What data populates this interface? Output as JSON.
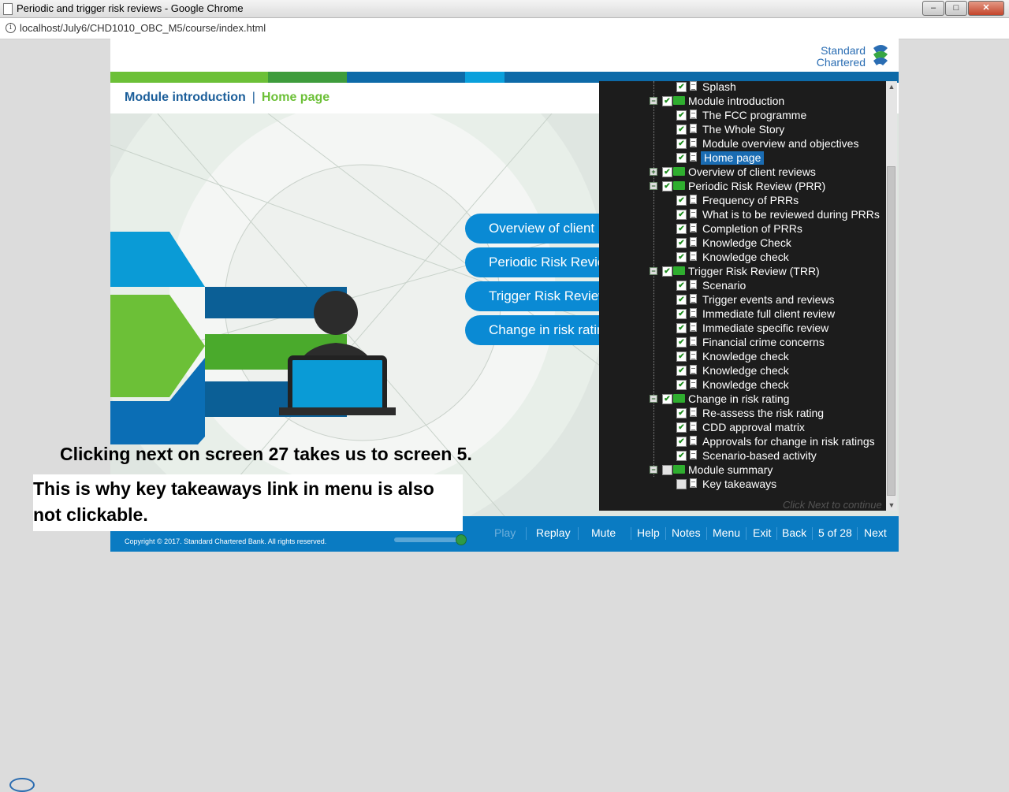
{
  "window": {
    "title": "Periodic and trigger risk reviews - Google Chrome",
    "url": "localhost/July6/CHD1010_OBC_M5/course/index.html",
    "controls": [
      "minimize-icon",
      "maximize-icon",
      "close-icon"
    ]
  },
  "course": {
    "logo": {
      "line1": "Standard",
      "line2": "Chartered",
      "icon": "standard-chartered-logo-icon"
    },
    "stripe_colors": [
      "#6cc037",
      "#3e9c3c",
      "#0d6aa8",
      "#0aa0dc",
      "#0d6aa8"
    ],
    "breadcrumb": {
      "section": "Module introduction",
      "page": "Home page"
    },
    "menu_items": [
      "Overview of client reviews",
      "Periodic Risk Review (PRR)",
      "Trigger Risk Review (TRR)",
      "Change in risk ratings"
    ],
    "footer": {
      "copyright": "Copyright © 2017. Standard Chartered Bank. All rights reserved.",
      "volume_level": 1.0,
      "nav": {
        "play": "Play",
        "replay": "Replay",
        "mute": "Mute",
        "help": "Help",
        "notes": "Notes",
        "menu": "Menu",
        "exit": "Exit",
        "back": "Back",
        "page_indicator": "5 of 28",
        "next": "Next"
      }
    },
    "hint_text": "Click Next to continue"
  },
  "tree": {
    "rows": [
      {
        "label": "Splash",
        "type": "page",
        "level": 2,
        "checked": true
      },
      {
        "label": "Module introduction",
        "type": "folder",
        "level": 1,
        "checked": true,
        "expanded": true
      },
      {
        "label": "The FCC programme",
        "type": "page",
        "level": 2,
        "checked": true
      },
      {
        "label": "The Whole Story",
        "type": "page",
        "level": 2,
        "checked": true
      },
      {
        "label": "Module overview and objectives",
        "type": "page",
        "level": 2,
        "checked": true
      },
      {
        "label": "Home page",
        "type": "page",
        "level": 2,
        "checked": true,
        "selected": true
      },
      {
        "label": "Overview of client reviews",
        "type": "folder",
        "level": 1,
        "checked": true,
        "expanded": false
      },
      {
        "label": "Periodic Risk Review (PRR)",
        "type": "folder",
        "level": 1,
        "checked": true,
        "expanded": true
      },
      {
        "label": "Frequency of PRRs",
        "type": "page",
        "level": 2,
        "checked": true
      },
      {
        "label": "What is to be reviewed during PRRs",
        "type": "page",
        "level": 2,
        "checked": true
      },
      {
        "label": "Completion of PRRs",
        "type": "page",
        "level": 2,
        "checked": true
      },
      {
        "label": "Knowledge Check",
        "type": "page",
        "level": 2,
        "checked": true
      },
      {
        "label": "Knowledge check",
        "type": "page",
        "level": 2,
        "checked": true
      },
      {
        "label": "Trigger Risk Review (TRR)",
        "type": "folder",
        "level": 1,
        "checked": true,
        "expanded": true
      },
      {
        "label": "Scenario",
        "type": "page",
        "level": 2,
        "checked": true
      },
      {
        "label": "Trigger events and reviews",
        "type": "page",
        "level": 2,
        "checked": true
      },
      {
        "label": "Immediate full client review",
        "type": "page",
        "level": 2,
        "checked": true
      },
      {
        "label": "Immediate specific review",
        "type": "page",
        "level": 2,
        "checked": true
      },
      {
        "label": "Financial crime concerns",
        "type": "page",
        "level": 2,
        "checked": true
      },
      {
        "label": "Knowledge check",
        "type": "page",
        "level": 2,
        "checked": true
      },
      {
        "label": "Knowledge check",
        "type": "page",
        "level": 2,
        "checked": true
      },
      {
        "label": "Knowledge check",
        "type": "page",
        "level": 2,
        "checked": true
      },
      {
        "label": "Change in risk rating",
        "type": "folder",
        "level": 1,
        "checked": true,
        "expanded": true
      },
      {
        "label": "Re-assess the risk rating",
        "type": "page",
        "level": 2,
        "checked": true
      },
      {
        "label": "CDD approval matrix",
        "type": "page",
        "level": 2,
        "checked": true
      },
      {
        "label": "Approvals for change in risk ratings",
        "type": "page",
        "level": 2,
        "checked": true
      },
      {
        "label": "Scenario-based activity",
        "type": "page",
        "level": 2,
        "checked": true
      },
      {
        "label": "Module summary",
        "type": "folder",
        "level": 1,
        "checked": false,
        "expanded": true
      },
      {
        "label": "Key takeaways",
        "type": "page",
        "level": 2,
        "checked": false
      }
    ]
  },
  "annotations": {
    "line1": "Clicking next on screen 27 takes us to screen 5.",
    "line2a": "This is why key takeaways link in menu is also",
    "line2b": "not clickable."
  }
}
